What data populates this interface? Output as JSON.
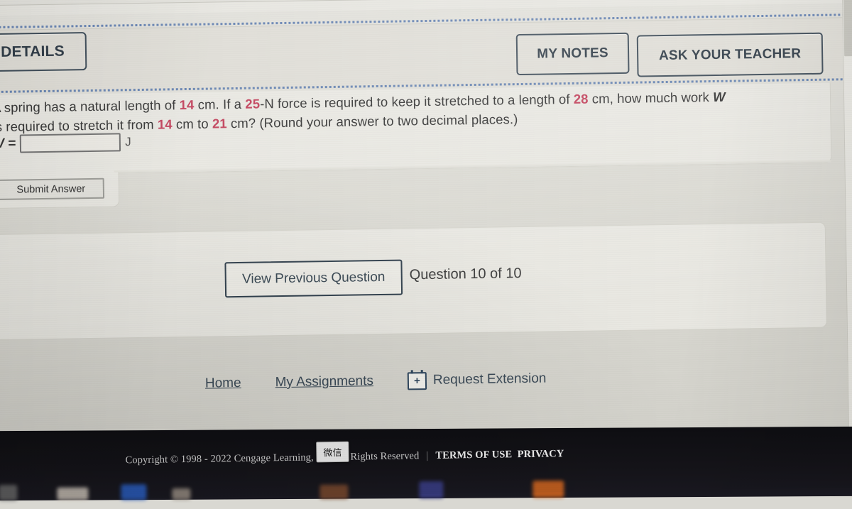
{
  "header": {
    "details_label": "DETAILS",
    "my_notes_label": "MY NOTES",
    "ask_teacher_label": "ASK YOUR TEACHER"
  },
  "question": {
    "line1_a": "A spring has a natural length of ",
    "val_natural_length": "14",
    "line1_b": " cm. If a ",
    "val_force": "25",
    "line1_c": "-N force is required to keep it stretched to a length of ",
    "val_stretched_length": "28",
    "line1_d": " cm, how much work ",
    "symbol_w": "W",
    "line2_a": "is required to stretch it from ",
    "val_from": "14",
    "line2_b": " cm to ",
    "val_to": "21",
    "line2_c": " cm? (Round your answer to two decimal places.)",
    "answer_label": "W =",
    "answer_value": "",
    "answer_placeholder": "",
    "answer_unit": "J"
  },
  "actions": {
    "submit_label": "Submit Answer",
    "view_previous_label": "View Previous Question",
    "question_counter": "Question 10 of 10"
  },
  "footer": {
    "home_label": "Home",
    "my_assignments_label": "My Assignments",
    "request_extension_label": "Request Extension",
    "request_extension_icon": "calendar-plus-icon"
  },
  "copyright": {
    "text": "Copyright © 1998 - 2022 Cengage Learning, Inc. All Rights Reserved",
    "separator": "|",
    "terms_label": "TERMS OF USE",
    "privacy_label": "PRIVACY"
  },
  "overlay": {
    "ime_badge": "微信"
  },
  "scrollbar": {
    "down_arrow_icon": "chevron-down-icon"
  },
  "colors": {
    "accent_number": "#c03a55",
    "button_outline": "#33424f",
    "page_background": "#e2e1db",
    "taskbar": "#141318"
  }
}
